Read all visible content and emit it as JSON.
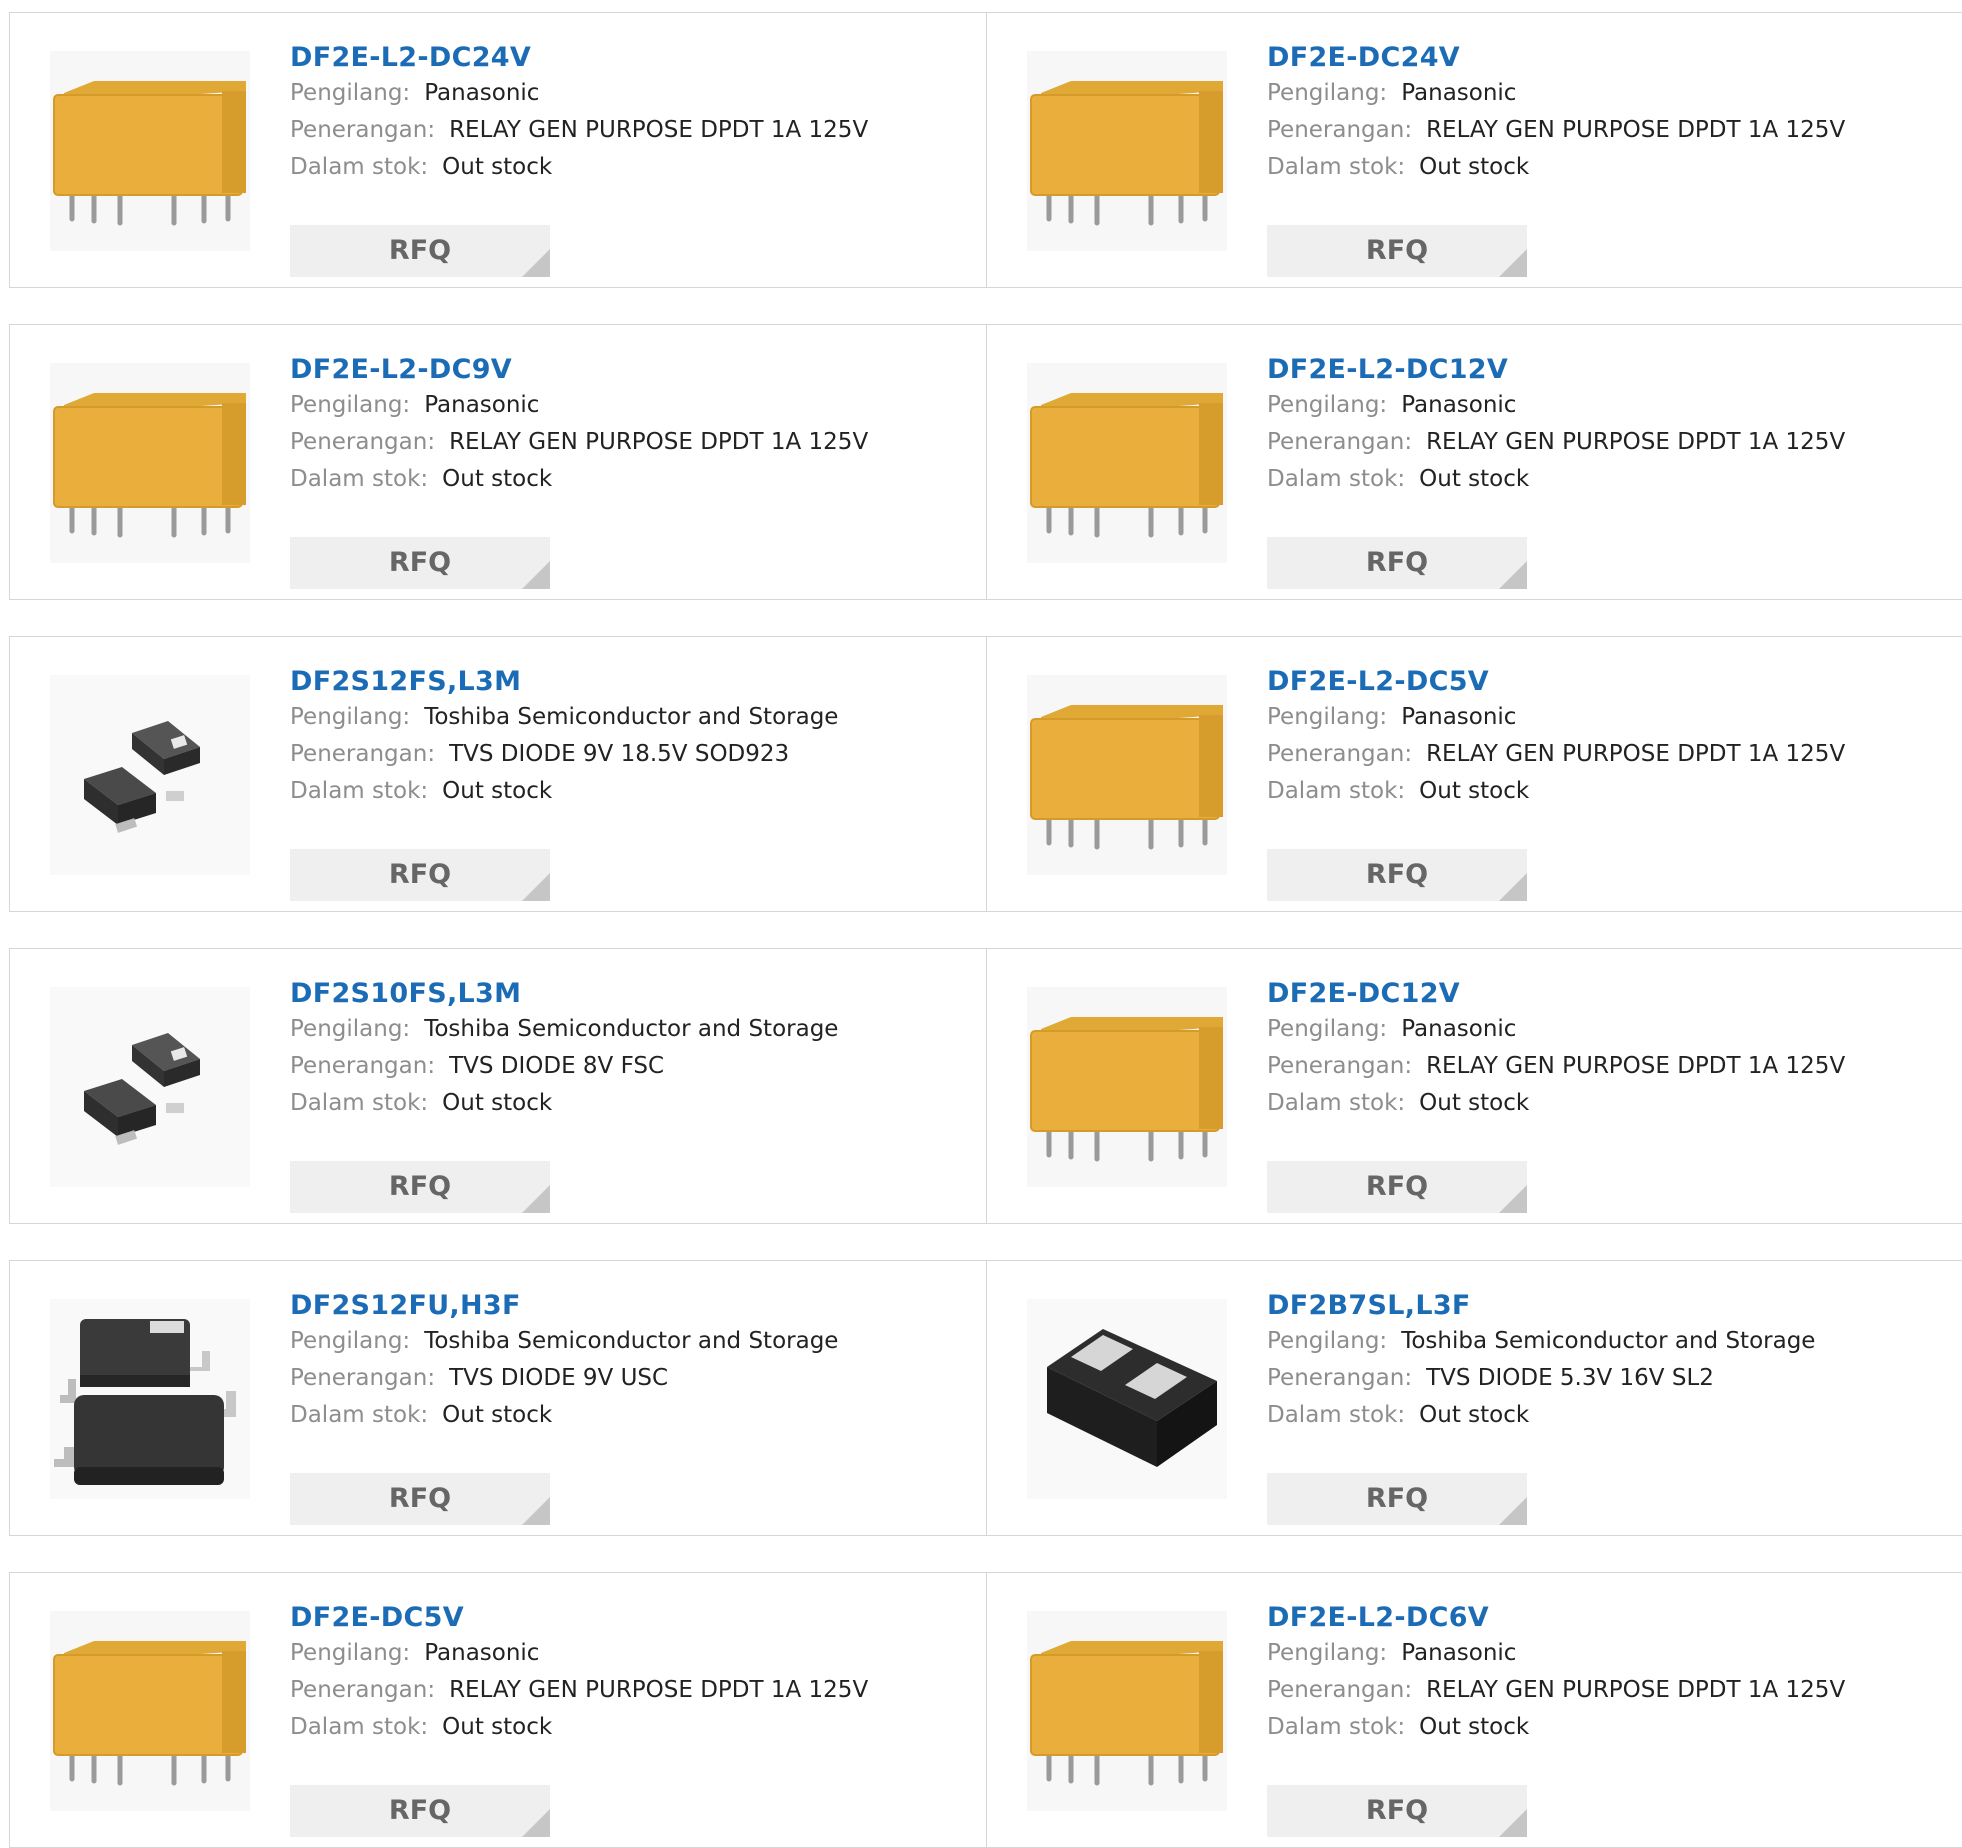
{
  "labels": {
    "manufacturer": "Pengilang:",
    "description": "Penerangan:",
    "stock": "Dalam stok:",
    "rfq": "RFQ"
  },
  "products": [
    {
      "part": "DF2E-L2-DC24V",
      "manufacturer": "Panasonic",
      "description": "RELAY GEN PURPOSE DPDT 1A 125V",
      "stock": "Out stock",
      "image": "relay-icon"
    },
    {
      "part": "DF2E-DC24V",
      "manufacturer": "Panasonic",
      "description": "RELAY GEN PURPOSE DPDT 1A 125V",
      "stock": "Out stock",
      "image": "relay-icon"
    },
    {
      "part": "DF2E-L2-DC9V",
      "manufacturer": "Panasonic",
      "description": "RELAY GEN PURPOSE DPDT 1A 125V",
      "stock": "Out stock",
      "image": "relay-icon"
    },
    {
      "part": "DF2E-L2-DC12V",
      "manufacturer": "Panasonic",
      "description": "RELAY GEN PURPOSE DPDT 1A 125V",
      "stock": "Out stock",
      "image": "relay-icon"
    },
    {
      "part": "DF2S12FS,L3M",
      "manufacturer": "Toshiba Semiconductor and Storage",
      "description": "TVS DIODE 9V 18.5V SOD923",
      "stock": "Out stock",
      "image": "sod-diode-icon"
    },
    {
      "part": "DF2E-L2-DC5V",
      "manufacturer": "Panasonic",
      "description": "RELAY GEN PURPOSE DPDT 1A 125V",
      "stock": "Out stock",
      "image": "relay-icon"
    },
    {
      "part": "DF2S10FS,L3M",
      "manufacturer": "Toshiba Semiconductor and Storage",
      "description": "TVS DIODE 8V FSC",
      "stock": "Out stock",
      "image": "sod-diode-icon"
    },
    {
      "part": "DF2E-DC12V",
      "manufacturer": "Panasonic",
      "description": "RELAY GEN PURPOSE DPDT 1A 125V",
      "stock": "Out stock",
      "image": "relay-icon"
    },
    {
      "part": "DF2S12FU,H3F",
      "manufacturer": "Toshiba Semiconductor and Storage",
      "description": "TVS DIODE 9V USC",
      "stock": "Out stock",
      "image": "usc-diode-icon"
    },
    {
      "part": "DF2B7SL,L3F",
      "manufacturer": "Toshiba Semiconductor and Storage",
      "description": "TVS DIODE 5.3V 16V SL2",
      "stock": "Out stock",
      "image": "sl2-diode-icon"
    },
    {
      "part": "DF2E-DC5V",
      "manufacturer": "Panasonic",
      "description": "RELAY GEN PURPOSE DPDT 1A 125V",
      "stock": "Out stock",
      "image": "relay-icon"
    },
    {
      "part": "DF2E-L2-DC6V",
      "manufacturer": "Panasonic",
      "description": "RELAY GEN PURPOSE DPDT 1A 125V",
      "stock": "Out stock",
      "image": "relay-icon"
    }
  ]
}
